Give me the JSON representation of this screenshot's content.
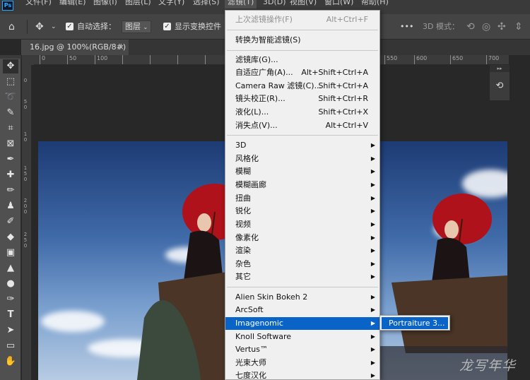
{
  "menubar": {
    "items": [
      "文件(F)",
      "编辑(E)",
      "图像(I)",
      "图层(L)",
      "文字(Y)",
      "选择(S)",
      "滤镜(T)",
      "3D(D)",
      "视图(V)",
      "窗口(W)",
      "帮助(H)"
    ],
    "logo": "Ps"
  },
  "options_bar": {
    "auto_select_label": "自动选择：",
    "auto_select_value": "图层",
    "show_transform_label": "显示变换控件",
    "more": "•••",
    "mode_3d_label": "3D 模式："
  },
  "document_tab": {
    "title": "16.jpg @ 100%(RGB/8#)",
    "close": "×"
  },
  "ruler": {
    "h_ticks": [
      "0",
      "50",
      "100",
      "550",
      "600",
      "650",
      "700"
    ],
    "v_ticks": [
      "0",
      "5",
      "0",
      "1",
      "0",
      "1",
      "5",
      "0",
      "2",
      "0",
      "0",
      "2",
      "5",
      "0"
    ]
  },
  "filter_menu": {
    "last_filter": {
      "label": "上次滤镜操作(F)",
      "shortcut": "Alt+Ctrl+F"
    },
    "smart_filter": "转换为智能滤镜(S)",
    "group1": [
      {
        "label": "滤镜库(G)...",
        "shortcut": ""
      },
      {
        "label": "自适应广角(A)...",
        "shortcut": "Alt+Shift+Ctrl+A"
      },
      {
        "label": "Camera Raw 滤镜(C)...",
        "shortcut": "Shift+Ctrl+A"
      },
      {
        "label": "镜头校正(R)...",
        "shortcut": "Shift+Ctrl+R"
      },
      {
        "label": "液化(L)...",
        "shortcut": "Shift+Ctrl+X"
      },
      {
        "label": "消失点(V)...",
        "shortcut": "Alt+Ctrl+V"
      }
    ],
    "group2": [
      "3D",
      "风格化",
      "模糊",
      "模糊画廊",
      "扭曲",
      "锐化",
      "视频",
      "像素化",
      "渲染",
      "杂色",
      "其它"
    ],
    "group3": [
      "Alien Skin Bokeh 2",
      "ArcSoft",
      "Imagenomic",
      "Knoll Software",
      "Vertus™",
      "光束大师",
      "七度汉化"
    ],
    "highlighted": "Imagenomic"
  },
  "submenu": {
    "item": "Portraiture 3..."
  },
  "watermark": "龙写年华",
  "colors": {
    "highlight": "#0a64c8",
    "menu_bg": "#f0f0f0",
    "app_bg": "#282828"
  }
}
